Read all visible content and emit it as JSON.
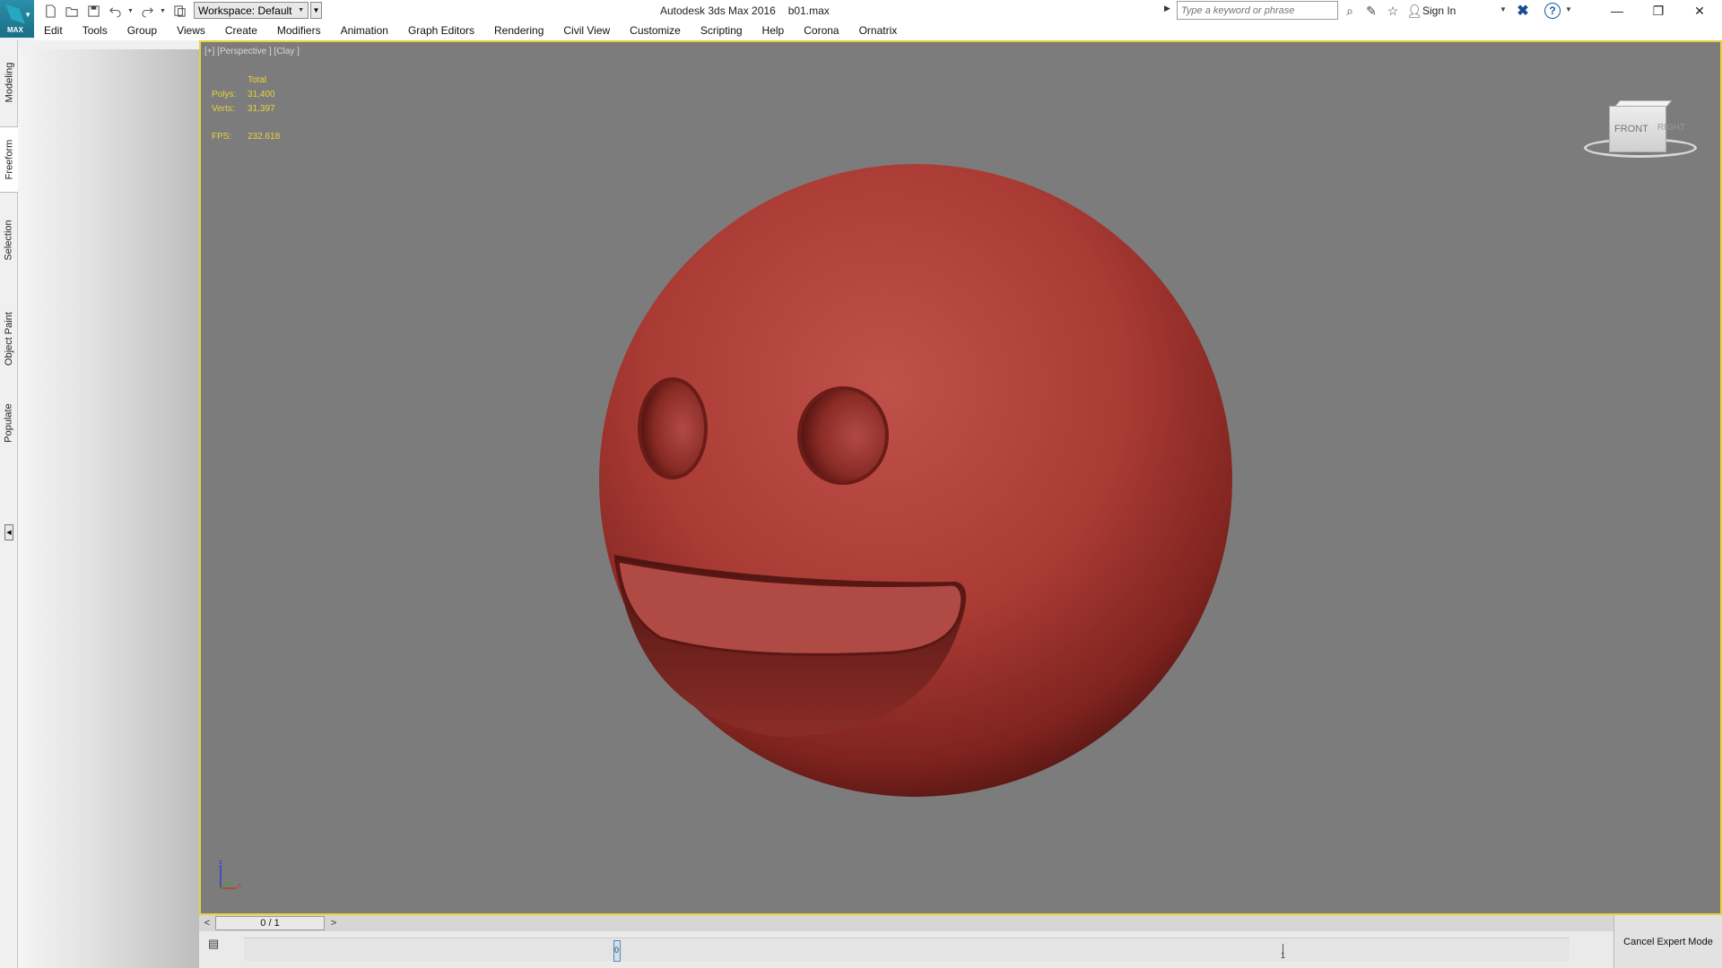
{
  "app": {
    "title": "Autodesk 3ds Max 2016",
    "file": "b01.max",
    "logo_text": "MAX"
  },
  "workspace": {
    "label": "Workspace: Default"
  },
  "search": {
    "placeholder": "Type a keyword or phrase"
  },
  "account": {
    "signin": "Sign In"
  },
  "menu": [
    "Edit",
    "Tools",
    "Group",
    "Views",
    "Create",
    "Modifiers",
    "Animation",
    "Graph Editors",
    "Rendering",
    "Civil View",
    "Customize",
    "Scripting",
    "Help",
    "Corona",
    "Ornatrix"
  ],
  "side_tabs": [
    "Modeling",
    "Freeform",
    "Selection",
    "Object Paint",
    "Populate"
  ],
  "viewport": {
    "label": "[+] [Perspective ] [Clay ]",
    "stats_header": "Total",
    "polys_label": "Polys:",
    "polys_value": "31,400",
    "verts_label": "Verts:",
    "verts_value": "31,397",
    "fps_label": "FPS:",
    "fps_value": "232.618",
    "viewcube_front": "FRONT",
    "viewcube_right": "RIGHT",
    "model_color": "#b3413b",
    "border_color": "#e6d23a"
  },
  "timeline": {
    "frame_display": "0 / 1",
    "prev_label": "<",
    "next_label": ">",
    "track_start": "0",
    "track_end": "1"
  },
  "status": {
    "cancel_expert": "Cancel Expert Mode"
  },
  "window_controls": {
    "minimize": "—",
    "restore": "❐",
    "close": "✕"
  }
}
